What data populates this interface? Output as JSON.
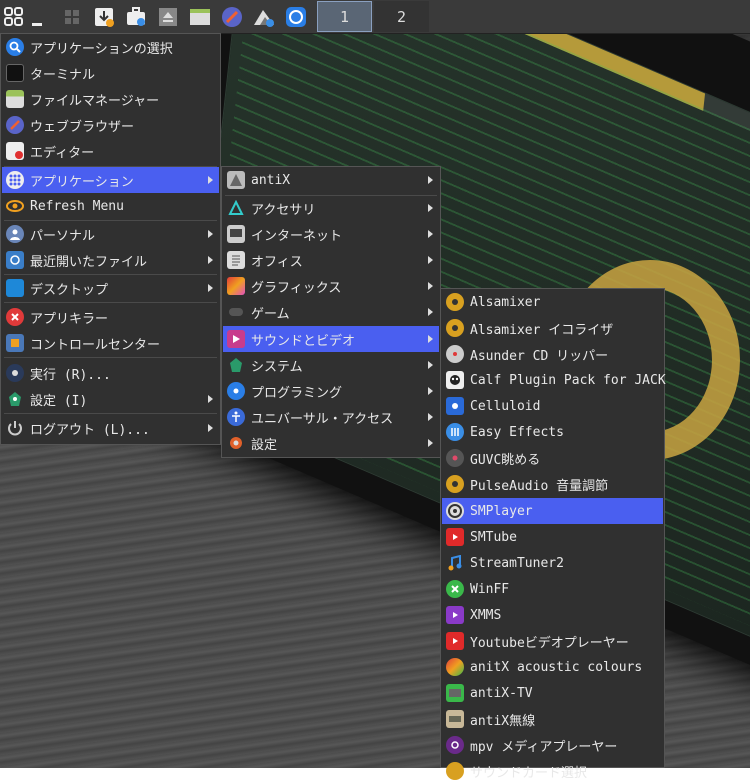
{
  "panel": {
    "workspaces": [
      "1",
      "2"
    ]
  },
  "main_menu": [
    {
      "label": "アプリケーションの選択",
      "icon": "search-icon"
    },
    {
      "label": "ターミナル",
      "icon": "terminal-icon"
    },
    {
      "label": "ファイルマネージャー",
      "icon": "file-manager-icon"
    },
    {
      "label": "ウェブブラウザー",
      "icon": "browser-icon"
    },
    {
      "label": "エディター",
      "icon": "editor-icon"
    },
    {
      "label": "アプリケーション",
      "icon": "apps-grid-icon"
    },
    {
      "label": "Refresh Menu",
      "icon": "refresh-icon"
    },
    {
      "label": "パーソナル",
      "icon": "person-icon"
    },
    {
      "label": "最近開いたファイル",
      "icon": "recent-files-icon"
    },
    {
      "label": "デスクトップ",
      "icon": "desktop-icon"
    },
    {
      "label": "アプリキラー",
      "icon": "kill-icon"
    },
    {
      "label": "コントロールセンター",
      "icon": "control-center-icon"
    },
    {
      "label": "実行 (R)...",
      "icon": "run-icon"
    },
    {
      "label": "設定 (I)",
      "icon": "settings-icon"
    },
    {
      "label": "ログアウト (L)...",
      "icon": "power-icon"
    }
  ],
  "apps_menu": [
    {
      "label": "antiX",
      "icon": "antix-icon"
    },
    {
      "label": "アクセサリ",
      "icon": "accessories-icon"
    },
    {
      "label": "インターネット",
      "icon": "internet-icon"
    },
    {
      "label": "オフィス",
      "icon": "office-icon"
    },
    {
      "label": "グラフィックス",
      "icon": "graphics-icon"
    },
    {
      "label": "ゲーム",
      "icon": "game-icon"
    },
    {
      "label": "サウンドとビデオ",
      "icon": "sound-video-icon"
    },
    {
      "label": "システム",
      "icon": "system-icon"
    },
    {
      "label": "プログラミング",
      "icon": "programming-icon"
    },
    {
      "label": "ユニバーサル・アクセス",
      "icon": "accessibility-icon"
    },
    {
      "label": "設定",
      "icon": "settings-gear-icon"
    }
  ],
  "media_menu": [
    {
      "label": "Alsamixer",
      "icon": "speaker-icon"
    },
    {
      "label": "Alsamixer イコライザ",
      "icon": "speaker-icon"
    },
    {
      "label": "Asunder CD リッパー",
      "icon": "cd-icon"
    },
    {
      "label": "Calf Plugin Pack for JACK",
      "icon": "calf-icon"
    },
    {
      "label": "Celluloid",
      "icon": "celluloid-icon"
    },
    {
      "label": "Easy Effects",
      "icon": "equalizer-icon"
    },
    {
      "label": "GUVC眺める",
      "icon": "webcam-icon"
    },
    {
      "label": "PulseAudio 音量調節",
      "icon": "speaker-icon"
    },
    {
      "label": "SMPlayer",
      "icon": "smplayer-icon"
    },
    {
      "label": "SMTube",
      "icon": "youtube-icon"
    },
    {
      "label": "StreamTuner2",
      "icon": "music-note-icon"
    },
    {
      "label": "WinFF",
      "icon": "winff-icon"
    },
    {
      "label": "XMMS",
      "icon": "xmms-icon"
    },
    {
      "label": "Youtubeビデオプレーヤー",
      "icon": "youtube-icon"
    },
    {
      "label": "anitX acoustic colours",
      "icon": "acoustic-icon"
    },
    {
      "label": "antiX-TV",
      "icon": "tv-icon"
    },
    {
      "label": "antiX無線",
      "icon": "radio-icon"
    },
    {
      "label": "mpv メディアプレーヤー",
      "icon": "mpv-icon"
    },
    {
      "label": "サウンドカード選択",
      "icon": "soundcard-icon"
    }
  ],
  "colors": {
    "highlight": "#4a5ff0",
    "menu_bg": "#303030"
  }
}
